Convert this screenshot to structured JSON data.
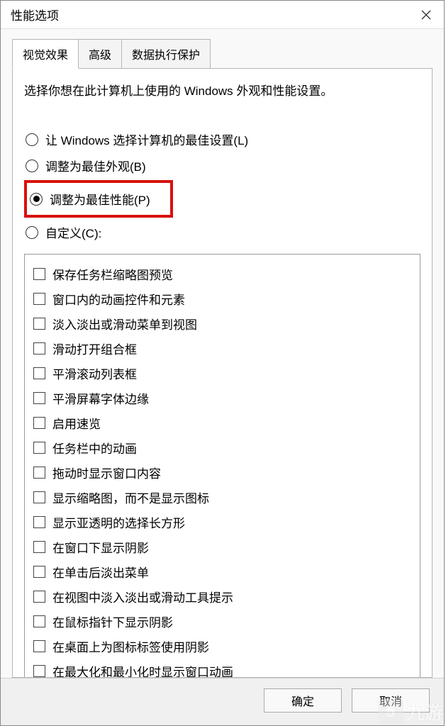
{
  "window": {
    "title": "性能选项"
  },
  "tabs": [
    {
      "label": "视觉效果",
      "active": true
    },
    {
      "label": "高级",
      "active": false
    },
    {
      "label": "数据执行保护",
      "active": false
    }
  ],
  "description": "选择你想在此计算机上使用的 Windows 外观和性能设置。",
  "radios": [
    {
      "label": "让 Windows 选择计算机的最佳设置(L)",
      "selected": false,
      "highlighted": false,
      "name": "radio-windows-choose"
    },
    {
      "label": "调整为最佳外观(B)",
      "selected": false,
      "highlighted": false,
      "name": "radio-best-appearance"
    },
    {
      "label": "调整为最佳性能(P)",
      "selected": true,
      "highlighted": true,
      "name": "radio-best-performance"
    },
    {
      "label": "自定义(C):",
      "selected": false,
      "highlighted": false,
      "name": "radio-custom"
    }
  ],
  "checkboxes": [
    {
      "label": "保存任务栏缩略图预览",
      "checked": false
    },
    {
      "label": "窗口内的动画控件和元素",
      "checked": false
    },
    {
      "label": "淡入淡出或滑动菜单到视图",
      "checked": false
    },
    {
      "label": "滑动打开组合框",
      "checked": false
    },
    {
      "label": "平滑滚动列表框",
      "checked": false
    },
    {
      "label": "平滑屏幕字体边缘",
      "checked": false
    },
    {
      "label": "启用速览",
      "checked": false
    },
    {
      "label": "任务栏中的动画",
      "checked": false
    },
    {
      "label": "拖动时显示窗口内容",
      "checked": false
    },
    {
      "label": "显示缩略图，而不是显示图标",
      "checked": false
    },
    {
      "label": "显示亚透明的选择长方形",
      "checked": false
    },
    {
      "label": "在窗口下显示阴影",
      "checked": false
    },
    {
      "label": "在单击后淡出菜单",
      "checked": false
    },
    {
      "label": "在视图中淡入淡出或滑动工具提示",
      "checked": false
    },
    {
      "label": "在鼠标指针下显示阴影",
      "checked": false
    },
    {
      "label": "在桌面上为图标标签使用阴影",
      "checked": false
    },
    {
      "label": "在最大化和最小化时显示窗口动画",
      "checked": false
    }
  ],
  "buttons": {
    "ok": "确定",
    "cancel": "取消"
  },
  "watermark": {
    "badge": "5",
    "text": "九游"
  }
}
